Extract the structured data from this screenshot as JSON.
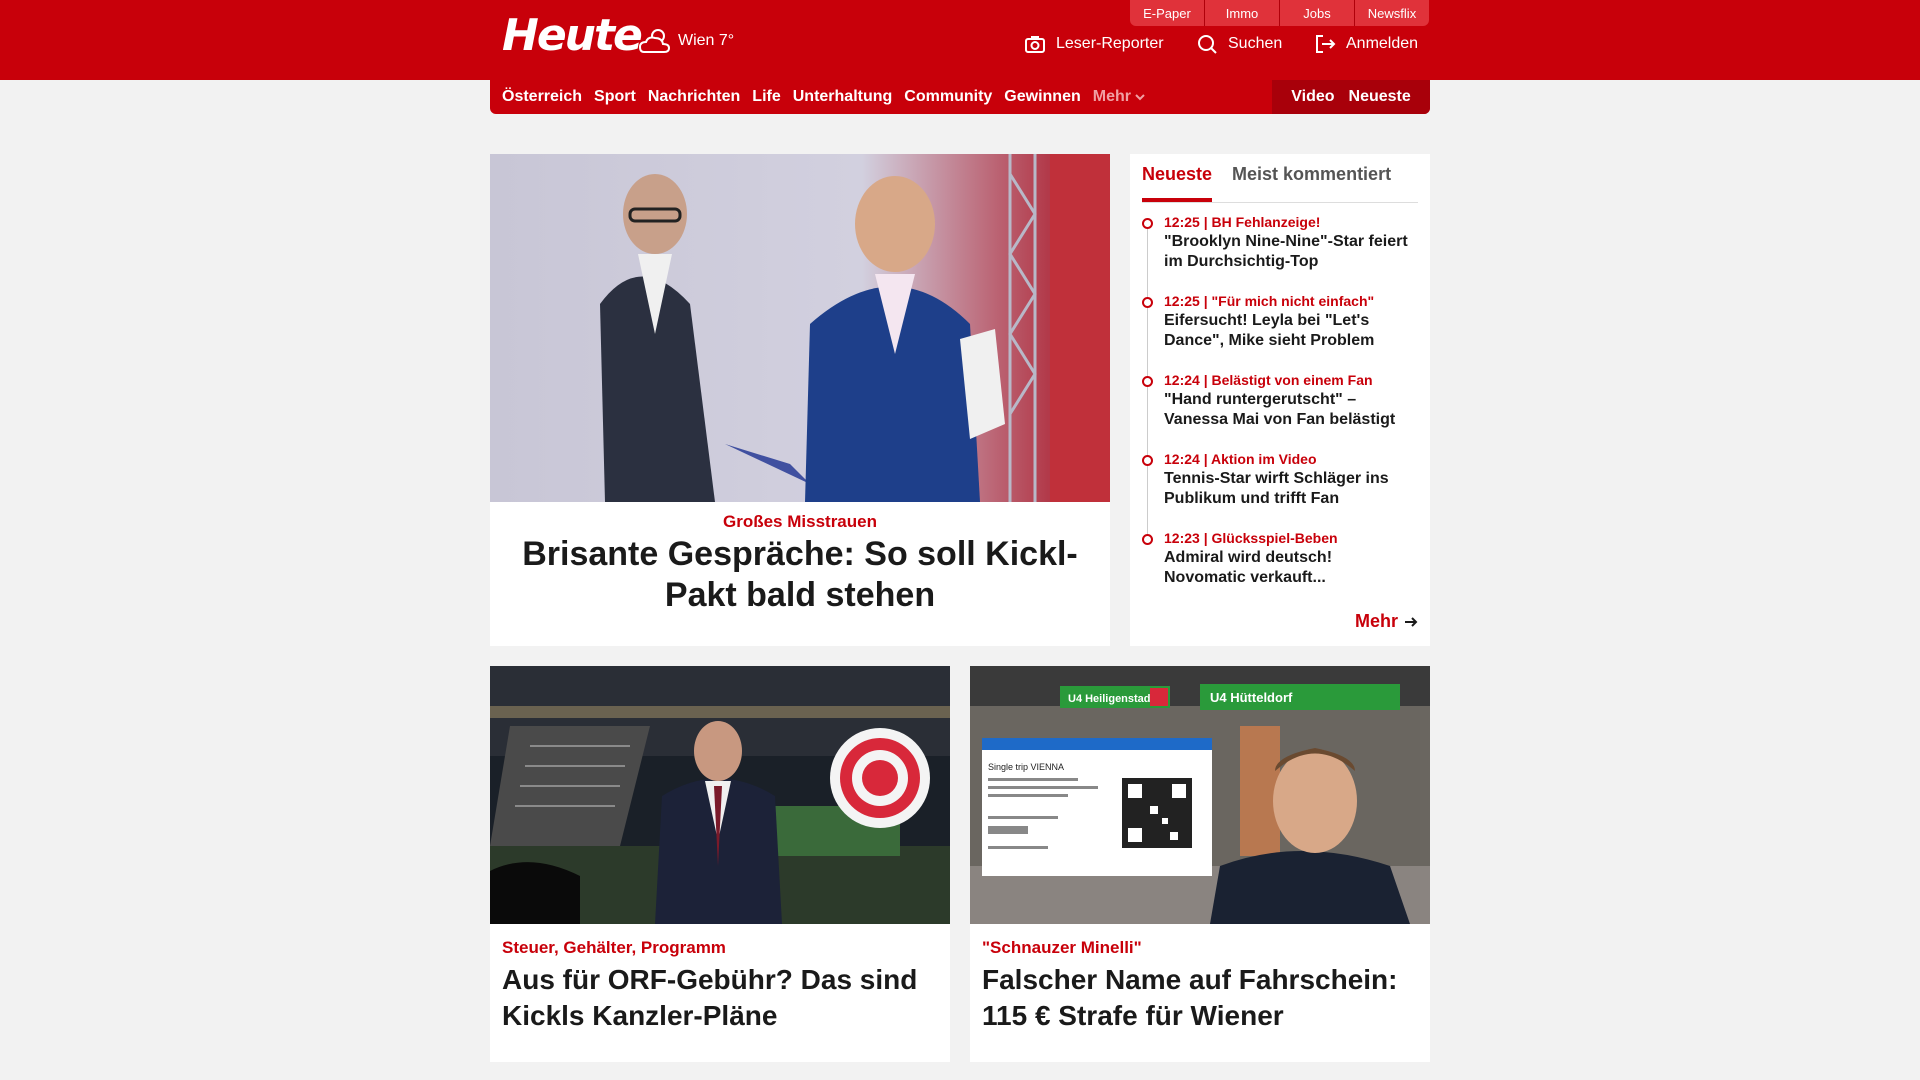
{
  "header": {
    "logo": "Heute",
    "weather": "Wien 7°",
    "top_tabs": [
      "E-Paper",
      "Immo",
      "Jobs",
      "Newsflix"
    ],
    "leser_reporter": "Leser-Reporter",
    "suchen": "Suchen",
    "anmelden": "Anmelden"
  },
  "nav": {
    "items": [
      "Österreich",
      "Sport",
      "Nachrichten",
      "Life",
      "Unterhaltung",
      "Community",
      "Gewinnen"
    ],
    "more": "Mehr",
    "video": "Video",
    "neueste": "Neueste"
  },
  "hero": {
    "kicker": "Großes Misstrauen",
    "title": "Brisante Gespräche: So soll Kickl-Pakt bald stehen"
  },
  "sidebar": {
    "tabs": [
      "Neueste",
      "Meist kommentiert"
    ],
    "items": [
      {
        "meta": "12:25 | BH Fehlanzeige!",
        "title": "\"Brooklyn Nine-Nine\"-Star feiert im Durchsichtig-Top"
      },
      {
        "meta": "12:25 | \"Für mich nicht einfach\"",
        "title": "Eifersucht! Leyla bei \"Let's Dance\", Mike sieht Problem"
      },
      {
        "meta": "12:24 | Belästigt von einem Fan",
        "title": "\"Hand runtergerutscht\" – Vanessa Mai von Fan belästigt"
      },
      {
        "meta": "12:24 | Aktion im Video",
        "title": "Tennis-Star wirft Schläger ins Publikum und trifft Fan"
      },
      {
        "meta": "12:23 | Glücksspiel-Beben",
        "title": "Admiral wird deutsch! Novomatic verkauft..."
      }
    ],
    "more": "Mehr"
  },
  "cards": [
    {
      "kicker": "Steuer, Gehälter, Programm",
      "title": "Aus für ORF-Gebühr? Das sind Kickls Kanzler-Pläne"
    },
    {
      "kicker": "\"Schnauzer Minelli\"",
      "title": "Falscher Name auf Fahrschein: 115 € Strafe für Wiener"
    }
  ],
  "images": {
    "ticket_title": "Single trip VIENNA",
    "sign_left": "U4 Heiligenstadt",
    "sign_right": "U4 Hütteldorf"
  }
}
